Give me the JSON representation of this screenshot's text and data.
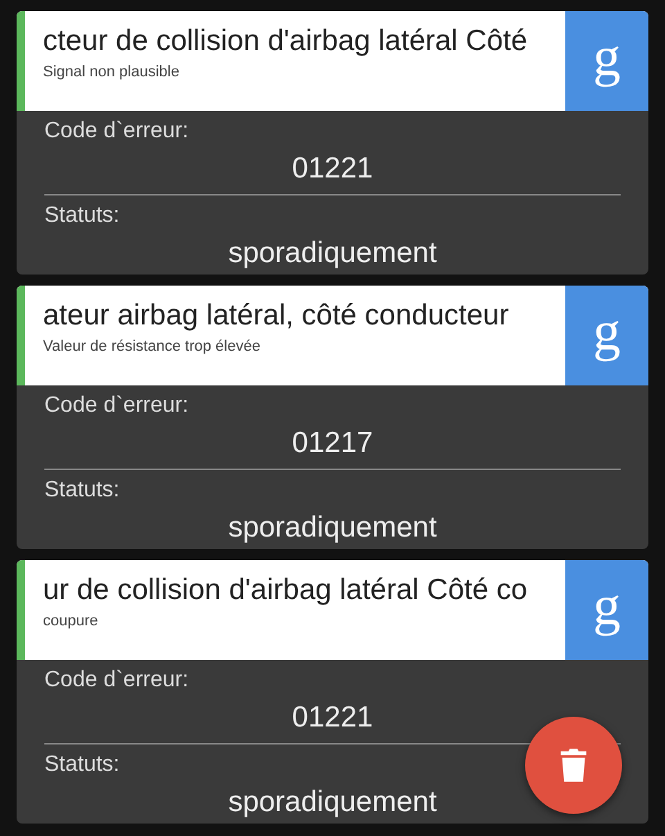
{
  "errors": [
    {
      "title": "cteur de collision d'airbag latéral Côté",
      "subtitle": "Signal non plausible",
      "search_label": "g",
      "code_label": "Code d`erreur:",
      "code": "01221",
      "status_label": "Statuts:",
      "status": "sporadiquement",
      "color": "#5cb85c"
    },
    {
      "title": "ateur airbag latéral, côté conducteur",
      "subtitle": "Valeur de résistance trop élevée",
      "search_label": "g",
      "code_label": "Code d`erreur:",
      "code": "01217",
      "status_label": "Statuts:",
      "status": "sporadiquement",
      "color": "#5cb85c"
    },
    {
      "title": "ur de collision d'airbag latéral Côté co",
      "subtitle": "coupure",
      "search_label": "g",
      "code_label": "Code d`erreur:",
      "code": "01221",
      "status_label": "Statuts:",
      "status": "sporadiquement",
      "color": "#5cb85c"
    }
  ]
}
